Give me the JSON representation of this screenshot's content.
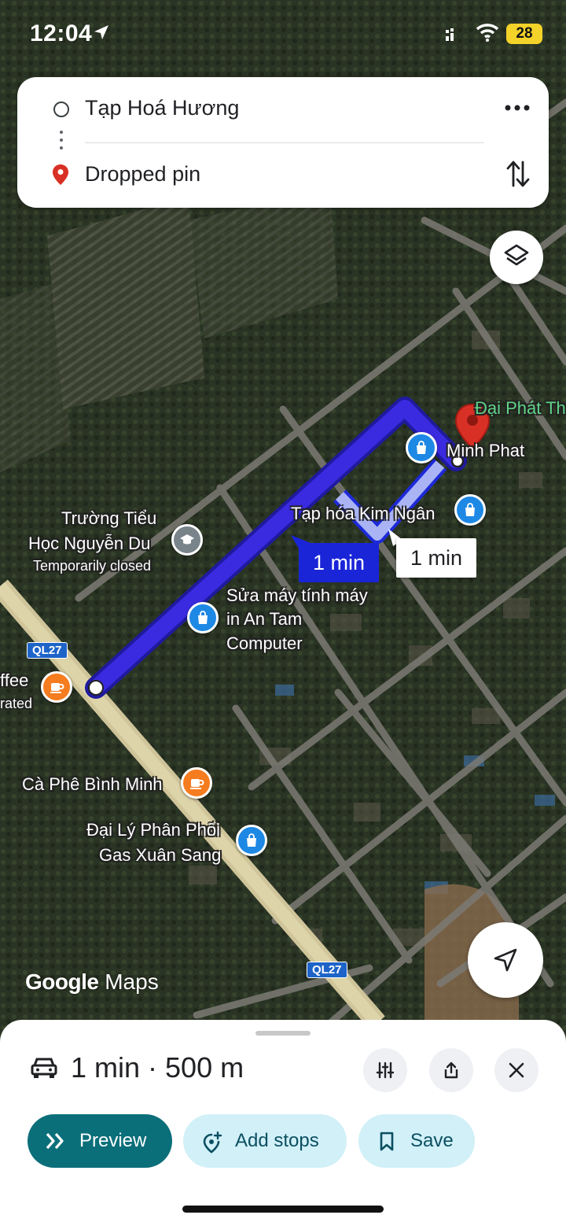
{
  "status_bar": {
    "time": "12:04",
    "battery": "28"
  },
  "route_card": {
    "origin": "Tạp Hoá Hương",
    "destination": "Dropped pin"
  },
  "map": {
    "labels": {
      "dai_phat": "Đại Phát Th",
      "minh_phat": "Minh Phat",
      "kim_ngan": "Tạp hóa Kim Ngân",
      "school_line1": "Trường Tiểu",
      "school_line2": "Học Nguyễn Du",
      "school_status": "Temporarily closed",
      "computer_line1": "Sửa máy tính máy",
      "computer_line2": "in An Tam",
      "computer_line3": "Computer",
      "coffee_line1": "ffee",
      "coffee_line2": "rated",
      "binh_minh": "Cà Phê Bình Minh",
      "gas_line1": "Đại Lý Phân Phối",
      "gas_line2": "Gas Xuân Sang"
    },
    "road_badge_1": "QL27",
    "road_badge_2": "QL27",
    "eta_primary": "1 min",
    "eta_alternate": "1 min",
    "attribution_google": "Google",
    "attribution_maps": "Maps"
  },
  "sheet": {
    "summary": "1 min · 500 m",
    "preview_label": "Preview",
    "add_stops_label": "Add stops",
    "save_label": "Save"
  },
  "colors": {
    "route_primary": "#3a2be0",
    "route_alternate": "#aab4f5",
    "preview_button": "#0b6f7a",
    "secondary_button": "#d1f0f8",
    "pin": "#d93025"
  },
  "icons": [
    "location-arrow-icon",
    "signal-icon",
    "wifi-icon",
    "more-icon",
    "swap-icon",
    "layers-icon",
    "navigate-icon",
    "car-icon",
    "options-icon",
    "share-icon",
    "close-icon",
    "preview-icon",
    "add-stop-icon",
    "bookmark-icon",
    "shopping-bag-icon",
    "cafe-icon",
    "school-icon",
    "dropped-pin-icon"
  ]
}
